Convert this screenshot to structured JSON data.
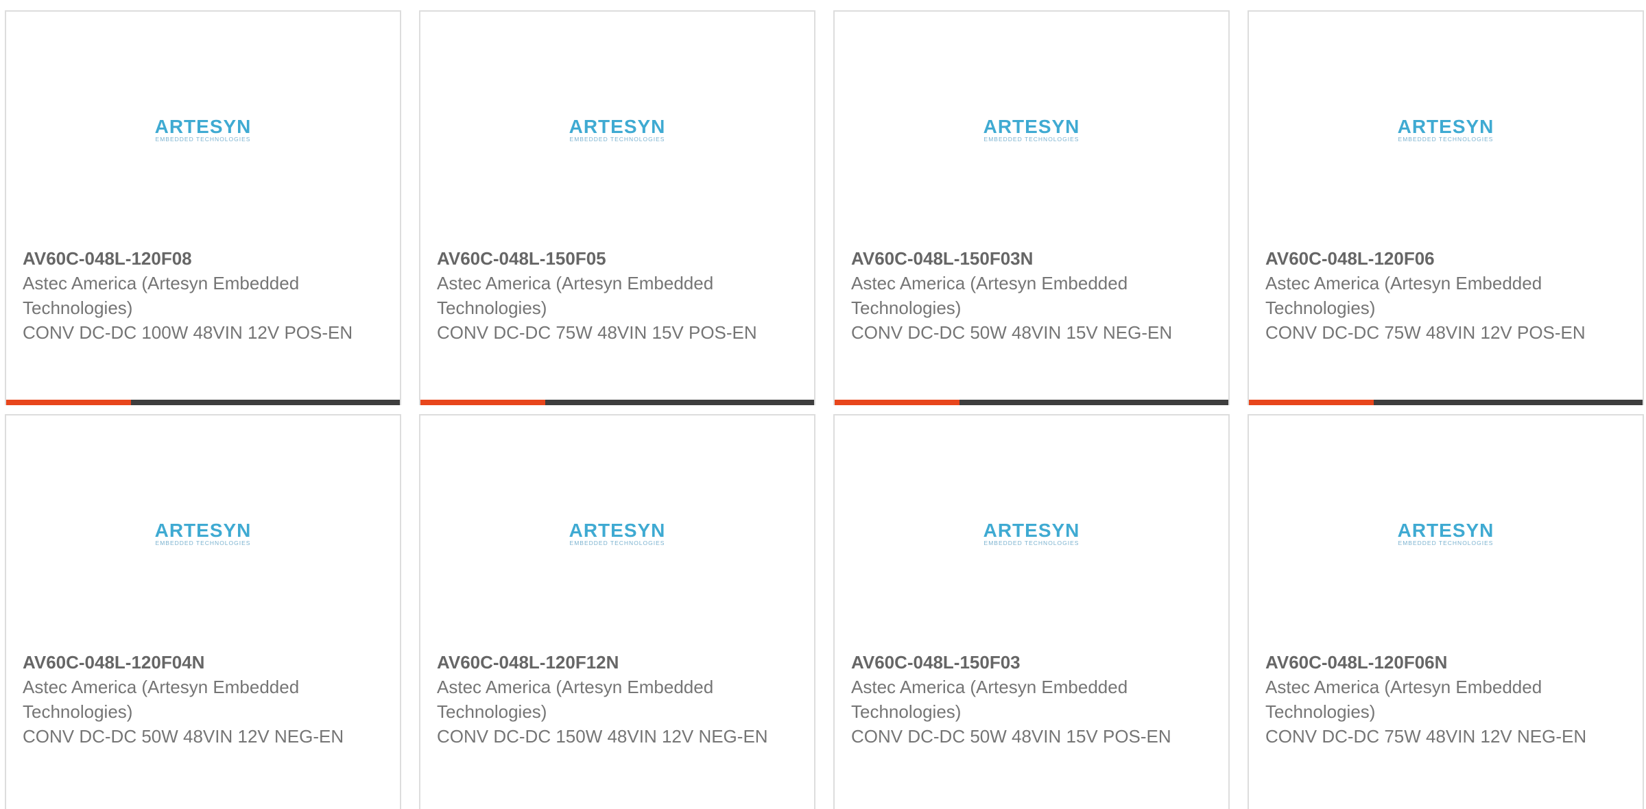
{
  "colors": {
    "accent_bar": "#e8461c",
    "dark_bar": "#3e3e3e",
    "logo_blue": "#1e9ccb",
    "logo_sub": "#5a9fc4"
  },
  "logo": {
    "name": "ARTESYN",
    "tagline": "EMBEDDED TECHNOLOGIES"
  },
  "products": [
    {
      "part_number": "AV60C-048L-120F08",
      "manufacturer": "Astec America (Artesyn Embedded Technologies)",
      "description": "CONV DC-DC 100W 48VIN 12V POS-EN"
    },
    {
      "part_number": "AV60C-048L-150F05",
      "manufacturer": "Astec America (Artesyn Embedded Technologies)",
      "description": "CONV DC-DC 75W 48VIN 15V POS-EN"
    },
    {
      "part_number": "AV60C-048L-150F03N",
      "manufacturer": "Astec America (Artesyn Embedded Technologies)",
      "description": "CONV DC-DC 50W 48VIN 15V NEG-EN"
    },
    {
      "part_number": "AV60C-048L-120F06",
      "manufacturer": "Astec America (Artesyn Embedded Technologies)",
      "description": "CONV DC-DC 75W 48VIN 12V POS-EN"
    },
    {
      "part_number": "AV60C-048L-120F04N",
      "manufacturer": "Astec America (Artesyn Embedded Technologies)",
      "description": "CONV DC-DC 50W 48VIN 12V NEG-EN"
    },
    {
      "part_number": "AV60C-048L-120F12N",
      "manufacturer": "Astec America (Artesyn Embedded Technologies)",
      "description": "CONV DC-DC 150W 48VIN 12V NEG-EN"
    },
    {
      "part_number": "AV60C-048L-150F03",
      "manufacturer": "Astec America (Artesyn Embedded Technologies)",
      "description": "CONV DC-DC 50W 48VIN 15V POS-EN"
    },
    {
      "part_number": "AV60C-048L-120F06N",
      "manufacturer": "Astec America (Artesyn Embedded Technologies)",
      "description": "CONV DC-DC 75W 48VIN 12V NEG-EN"
    }
  ]
}
